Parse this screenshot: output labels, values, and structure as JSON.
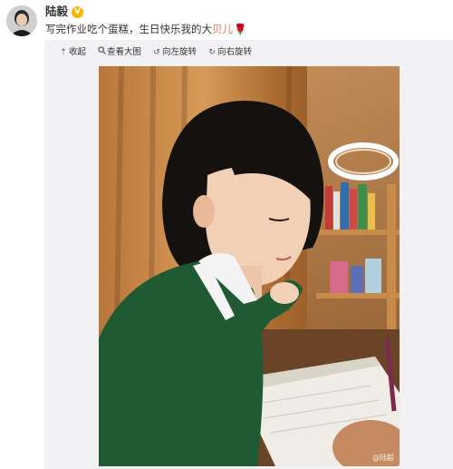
{
  "post": {
    "username": "陆毅",
    "verified_badge": "V",
    "text_main": "写完作业吃个蛋糕，生日快乐我的大",
    "text_mention": "贝儿",
    "text_emoji": "🌹"
  },
  "toolbar": {
    "items": [
      {
        "icon": "collapse-up-icon",
        "glyph": "⇡",
        "label": "收起"
      },
      {
        "icon": "zoom-icon",
        "glyph": "🔍",
        "label": "查看大图"
      },
      {
        "icon": "rotate-left-icon",
        "glyph": "↺",
        "label": "向左旋转"
      },
      {
        "icon": "rotate-right-icon",
        "glyph": "↻",
        "label": "向右旋转"
      }
    ]
  },
  "photo": {
    "watermark": "@陆毅"
  },
  "colors": {
    "mention": "#eb7350",
    "panel_bg": "#f2f2f5",
    "verified": "#f7b500"
  }
}
